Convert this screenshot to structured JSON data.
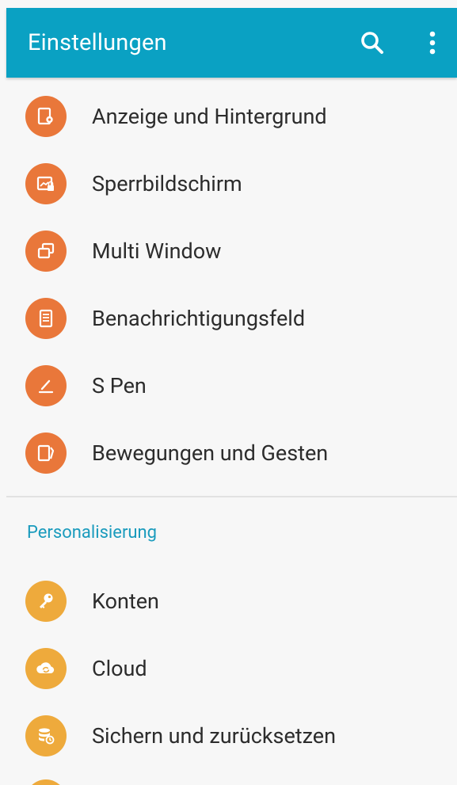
{
  "appbar": {
    "title": "Einstellungen",
    "search_icon": "search-icon",
    "more_icon": "more-vert-icon",
    "color": "#0aa1c3"
  },
  "device_items": [
    {
      "label": "Anzeige und Hintergrund",
      "icon": "display-wallpaper-icon",
      "color": "#e9773a"
    },
    {
      "label": "Sperrbildschirm",
      "icon": "lock-screen-icon",
      "color": "#e9773a"
    },
    {
      "label": "Multi Window",
      "icon": "multi-window-icon",
      "color": "#e9773a"
    },
    {
      "label": "Benachrichtigungsfeld",
      "icon": "notification-panel-icon",
      "color": "#e9773a"
    },
    {
      "label": "S Pen",
      "icon": "s-pen-icon",
      "color": "#e9773a"
    },
    {
      "label": "Bewegungen und Gesten",
      "icon": "motions-gestures-icon",
      "color": "#e9773a"
    }
  ],
  "personalization": {
    "header": "Personalisierung",
    "header_color": "#1a9bbd",
    "items": [
      {
        "label": "Konten",
        "icon": "key-icon",
        "color": "#eeaa3c"
      },
      {
        "label": "Cloud",
        "icon": "cloud-sync-icon",
        "color": "#eeaa3c"
      },
      {
        "label": "Sichern und zurücksetzen",
        "icon": "backup-reset-icon",
        "color": "#eeaa3c"
      }
    ]
  }
}
